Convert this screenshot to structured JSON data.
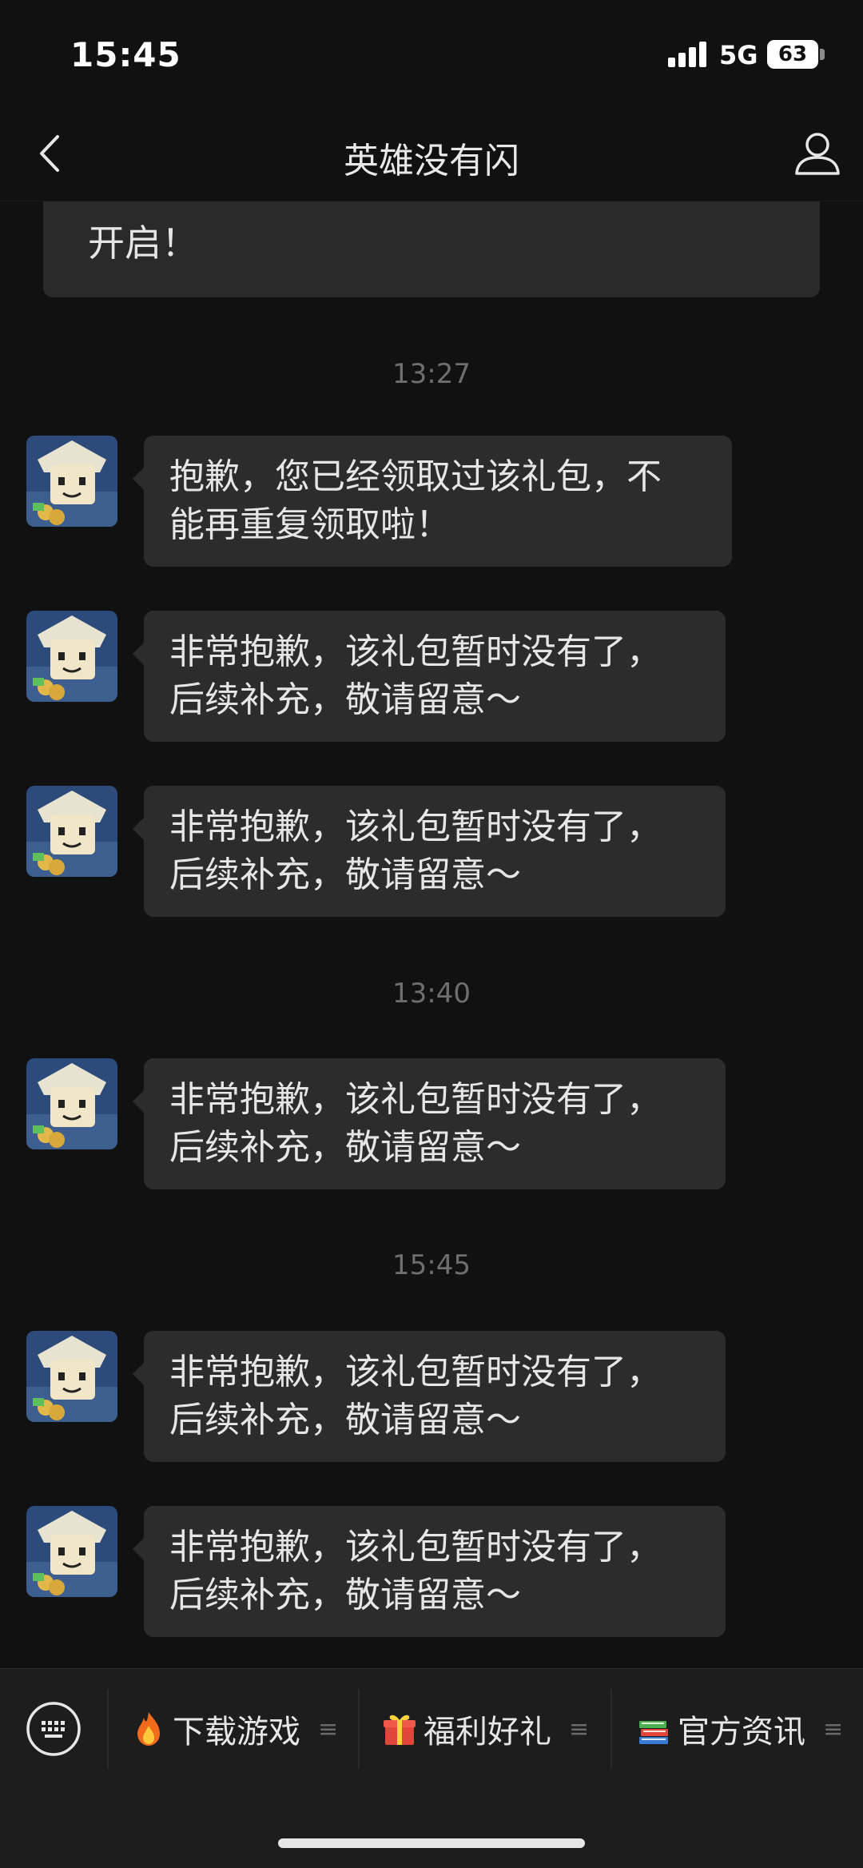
{
  "status_bar": {
    "time": "15:45",
    "network": "5G",
    "battery": "63"
  },
  "header": {
    "title": "英雄没有闪"
  },
  "chat": {
    "partial_message": "开启！",
    "timestamps": [
      "13:27",
      "13:40",
      "15:45"
    ],
    "messages": [
      {
        "line1": "抱歉，您已经领取过该礼包，不",
        "line2": "能再重复领取啦！"
      },
      {
        "line1": "非常抱歉，该礼包暂时没有了，",
        "line2": "后续补充，敬请留意～"
      },
      {
        "line1": "非常抱歉，该礼包暂时没有了，",
        "line2": "后续补充，敬请留意～"
      },
      {
        "line1": "非常抱歉，该礼包暂时没有了，",
        "line2": "后续补充，敬请留意～"
      },
      {
        "line1": "非常抱歉，该礼包暂时没有了，",
        "line2": "后续补充，敬请留意～"
      },
      {
        "line1": "非常抱歉，该礼包暂时没有了，",
        "line2": "后续补充，敬请留意～"
      }
    ]
  },
  "bottom_menu": {
    "items": [
      {
        "label": "下载游戏",
        "icon": "fire-icon"
      },
      {
        "label": "福利好礼",
        "icon": "gift-icon"
      },
      {
        "label": "官方资讯",
        "icon": "books-icon"
      }
    ],
    "menu_glyph": "≡"
  },
  "colors": {
    "background": "#111111",
    "bubble": "#2c2c2c",
    "menu_bar": "#1d1d1d",
    "timestamp": "#6e6e6e"
  }
}
